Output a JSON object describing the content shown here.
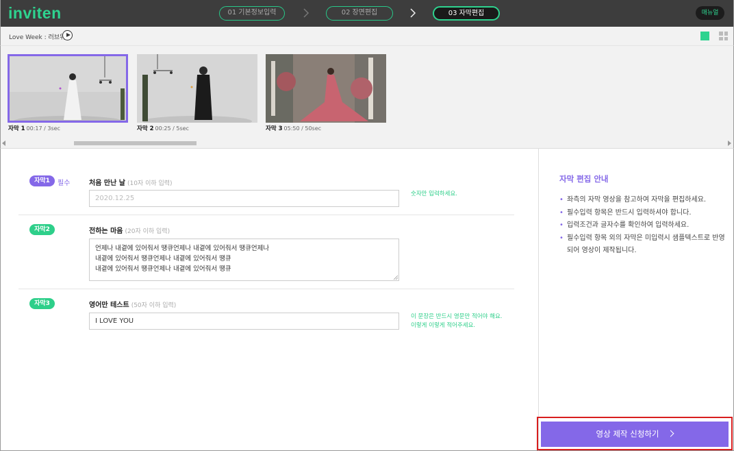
{
  "app": {
    "logo_text": "inviten",
    "manual_label": "매뉴얼",
    "brand_color": "#2ed38f",
    "accent_color": "#8468e8"
  },
  "steps": [
    {
      "num": "01",
      "label": "기본정보입력",
      "active": false
    },
    {
      "num": "02",
      "label": "장면편집",
      "active": false
    },
    {
      "num": "03",
      "label": "자막편집",
      "active": true
    }
  ],
  "subbar": {
    "project_title": "Love Week : 러브위크",
    "play_icon": "play-icon",
    "view_icons": [
      "single-view-icon",
      "grid-view-icon"
    ]
  },
  "thumbnails": [
    {
      "name": "자막 1",
      "time": "00:17 / 3sec",
      "selected": true
    },
    {
      "name": "자막 2",
      "time": "00:25 / 5sec",
      "selected": false
    },
    {
      "name": "자막 3",
      "time": "05:50 / 50sec",
      "selected": false
    }
  ],
  "fields": [
    {
      "badge": "자막1",
      "badge_color": "#8468e8",
      "required_label": "필수",
      "label": "처음 만난 날",
      "hint": "(10자 이하 입력)",
      "placeholder": "2020.12.25",
      "value": "",
      "note": "숫자만 입력하세요."
    },
    {
      "badge": "자막2",
      "badge_color": "#2ecf8a",
      "label": "전하는 마음",
      "hint": "(20자 이하 입력)",
      "value": "언제나 내곁에 있어줘서 땡큐언제나 내곁에 있어줘서 땡큐언제나\n내곁에 있어줘서 땡큐언제나 내곁에 있어줘서 땡큐\n내곁에 있어줘서 땡큐언제나 내곁에 있어줘서 땡큐"
    },
    {
      "badge": "자막3",
      "badge_color": "#2ecf8a",
      "label": "영어만 테스트",
      "hint": "(50자 이하 입력)",
      "value": "I LOVE YOU",
      "note_line1": "이 문장은 반드시 영문만 적어야 해요.",
      "note_line2": "이렇게 이렇게 적어주세요."
    }
  ],
  "guide": {
    "title": "자막 편집 안내",
    "items": [
      "좌측의 자막 영상을 참고하여 자막을 편집하세요.",
      "필수입력 항목은 반드시 입력하셔야 합니다.",
      "입력조건과 글자수를 확인하여 입력하세요.",
      "필수입력 항목 외의 자막은 미입력시 샘플텍스트로 반영되어 영상이 제작됩니다."
    ],
    "submit_label": "영상 제작 신청하기"
  }
}
